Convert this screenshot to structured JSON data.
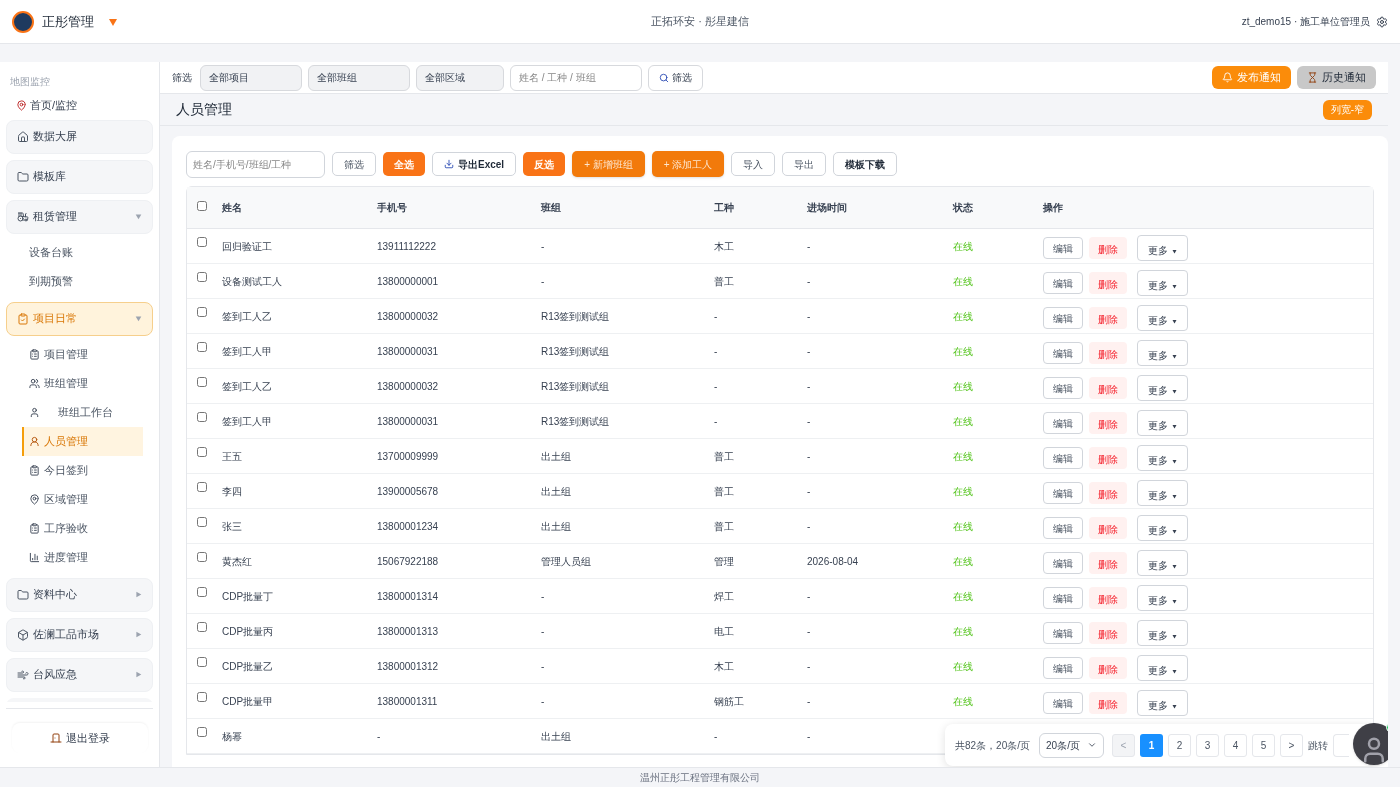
{
  "header": {
    "app_name": "正彤管理",
    "center_title": "正拓环安 · 彤星建信",
    "user": "zt_demo15 · 施工单位管理员"
  },
  "sidebar": {
    "section_label": "地图监控",
    "items": [
      {
        "label": "首页/监控",
        "kind": "link"
      },
      {
        "label": "数据大屏",
        "kind": "group"
      },
      {
        "label": "模板库",
        "kind": "group"
      },
      {
        "label": "租赁管理",
        "kind": "group",
        "expanded": true,
        "selected": false,
        "children": [
          {
            "label": "设备台账",
            "selected": false
          },
          {
            "label": "到期预警",
            "selected": false
          }
        ]
      },
      {
        "label": "项目日常",
        "kind": "group",
        "expanded": true,
        "selected": true,
        "children": [
          {
            "label": "项目管理",
            "selected": false
          },
          {
            "label": "班组管理",
            "selected": false
          },
          {
            "label": "班组工作台",
            "selected": false
          },
          {
            "label": "人员管理",
            "selected": true
          },
          {
            "label": "今日签到",
            "selected": false
          },
          {
            "label": "区域管理",
            "selected": false
          },
          {
            "label": "工序验收",
            "selected": false
          },
          {
            "label": "进度管理",
            "selected": false
          }
        ]
      },
      {
        "label": "资料中心",
        "kind": "group",
        "expanded": false,
        "selected": false
      },
      {
        "label": "佐澜工品市场",
        "kind": "group",
        "expanded": false,
        "selected": false
      },
      {
        "label": "台风应急",
        "kind": "group",
        "expanded": false,
        "selected": false
      }
    ],
    "logout": "退出登录"
  },
  "filter_bar": {
    "label": "筛选",
    "selects": [
      "全部项目",
      "全部班组",
      "全部区域"
    ],
    "search_placeholder": "姓名 / 工种 / 班组",
    "search_button": "筛选",
    "actions": [
      {
        "label": "发布通知",
        "kind": "primary"
      },
      {
        "label": "历史通知",
        "kind": "secondary"
      }
    ]
  },
  "page": {
    "title": "人员管理",
    "column_width_button": "列宽-窄"
  },
  "toolbar": {
    "search_placeholder": "姓名/手机号/班组/工种",
    "buttons": [
      {
        "label": "筛选",
        "kind": "default"
      },
      {
        "label": "全选",
        "kind": "primary"
      },
      {
        "label": "导出Excel",
        "kind": "export"
      },
      {
        "label": "反选",
        "kind": "primary"
      },
      {
        "label": "+ 新增班组",
        "kind": "accent"
      },
      {
        "label": "+ 添加工人",
        "kind": "accent"
      },
      {
        "label": "导入",
        "kind": "default"
      },
      {
        "label": "导出",
        "kind": "default"
      },
      {
        "label": "模板下载",
        "kind": "strong"
      }
    ]
  },
  "table": {
    "header_checked": false,
    "columns": [
      "姓名",
      "手机号",
      "班组",
      "工种",
      "进场时间",
      "状态",
      "操作"
    ],
    "rows": [
      {
        "checked": false,
        "name": "回归验证工",
        "phone": "13911112222",
        "team": "-",
        "trade": "木工",
        "entry_date": "-",
        "status": "在线",
        "actions": [
          "编辑",
          "删除",
          "更多"
        ]
      },
      {
        "checked": false,
        "name": "设备测试工人",
        "phone": "13800000001",
        "team": "-",
        "trade": "普工",
        "entry_date": "-",
        "status": "在线",
        "actions": [
          "编辑",
          "删除",
          "更多"
        ]
      },
      {
        "checked": false,
        "name": "签到工人乙",
        "phone": "13800000032",
        "team": "R13签到测试组",
        "trade": "-",
        "entry_date": "-",
        "status": "在线",
        "actions": [
          "编辑",
          "删除",
          "更多"
        ]
      },
      {
        "checked": false,
        "name": "签到工人甲",
        "phone": "13800000031",
        "team": "R13签到测试组",
        "trade": "-",
        "entry_date": "-",
        "status": "在线",
        "actions": [
          "编辑",
          "删除",
          "更多"
        ]
      },
      {
        "checked": false,
        "name": "签到工人乙",
        "phone": "13800000032",
        "team": "R13签到测试组",
        "trade": "-",
        "entry_date": "-",
        "status": "在线",
        "actions": [
          "编辑",
          "删除",
          "更多"
        ]
      },
      {
        "checked": false,
        "name": "签到工人甲",
        "phone": "13800000031",
        "team": "R13签到测试组",
        "trade": "-",
        "entry_date": "-",
        "status": "在线",
        "actions": [
          "编辑",
          "删除",
          "更多"
        ]
      },
      {
        "checked": false,
        "name": "王五",
        "phone": "13700009999",
        "team": "出土组",
        "trade": "普工",
        "entry_date": "-",
        "status": "在线",
        "actions": [
          "编辑",
          "删除",
          "更多"
        ]
      },
      {
        "checked": false,
        "name": "李四",
        "phone": "13900005678",
        "team": "出土组",
        "trade": "普工",
        "entry_date": "-",
        "status": "在线",
        "actions": [
          "编辑",
          "删除",
          "更多"
        ]
      },
      {
        "checked": false,
        "name": "张三",
        "phone": "13800001234",
        "team": "出土组",
        "trade": "普工",
        "entry_date": "-",
        "status": "在线",
        "actions": [
          "编辑",
          "删除",
          "更多"
        ]
      },
      {
        "checked": false,
        "name": "黄杰红",
        "phone": "15067922188",
        "team": "管理人员组",
        "trade": "管理",
        "entry_date": "2026-08-04",
        "status": "在线",
        "actions": [
          "编辑",
          "删除",
          "更多"
        ]
      },
      {
        "checked": false,
        "name": "CDP批量丁",
        "phone": "13800001314",
        "team": "-",
        "trade": "焊工",
        "entry_date": "-",
        "status": "在线",
        "actions": [
          "编辑",
          "删除",
          "更多"
        ]
      },
      {
        "checked": false,
        "name": "CDP批量丙",
        "phone": "13800001313",
        "team": "-",
        "trade": "电工",
        "entry_date": "-",
        "status": "在线",
        "actions": [
          "编辑",
          "删除",
          "更多"
        ]
      },
      {
        "checked": false,
        "name": "CDP批量乙",
        "phone": "13800001312",
        "team": "-",
        "trade": "木工",
        "entry_date": "-",
        "status": "在线",
        "actions": [
          "编辑",
          "删除",
          "更多"
        ]
      },
      {
        "checked": false,
        "name": "CDP批量甲",
        "phone": "13800001311",
        "team": "-",
        "trade": "钢筋工",
        "entry_date": "-",
        "status": "在线",
        "actions": [
          "编辑",
          "删除",
          "更多"
        ]
      },
      {
        "checked": false,
        "name": "杨幂",
        "phone": "-",
        "team": "出土组",
        "trade": "-",
        "entry_date": "-"
      }
    ]
  },
  "pagination": {
    "summary": "共82条，20条/页",
    "page_size": "20条/页",
    "prev": "<",
    "pages": [
      {
        "label": "1",
        "selected": true
      },
      {
        "label": "2",
        "selected": false
      },
      {
        "label": "3",
        "selected": false
      },
      {
        "label": "4",
        "selected": false
      },
      {
        "label": "5",
        "selected": false
      }
    ],
    "next": ">",
    "jump_label": "跳转"
  },
  "footer": "温州正彤工程管理有限公司"
}
